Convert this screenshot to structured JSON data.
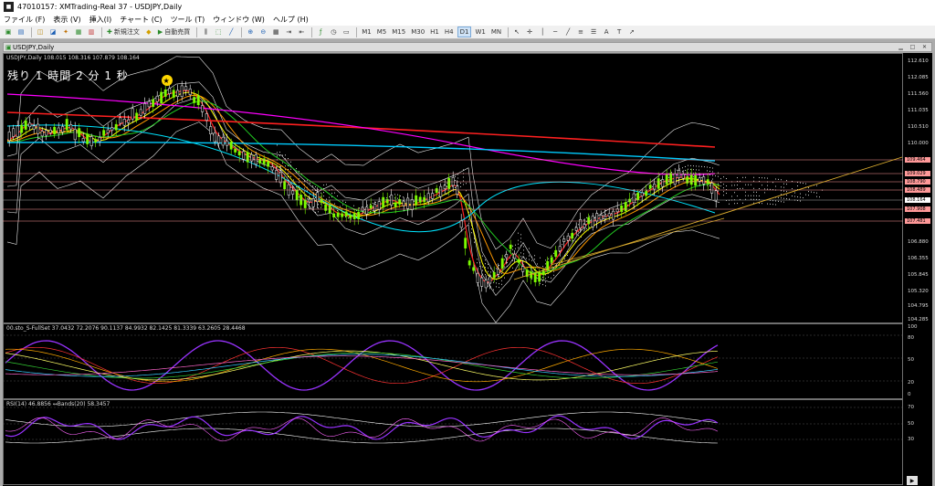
{
  "app": {
    "title": "47010157: XMTrading-Real 37 - USDJPY,Daily",
    "icon": "mt4-app-icon"
  },
  "menu": [
    "ファイル (F)",
    "表示 (V)",
    "挿入(I)",
    "チャート (C)",
    "ツール (T)",
    "ウィンドウ (W)",
    "ヘルプ (H)"
  ],
  "toolbar": {
    "new_order": "新規注文",
    "auto_trading": "自動売買",
    "timeframes": [
      "M1",
      "M5",
      "M15",
      "M30",
      "H1",
      "H4",
      "D1",
      "W1",
      "MN"
    ],
    "text_tool": "A"
  },
  "chart_window": {
    "title": "USDJPY,Daily",
    "header": "USDJPY,Daily 108.015 108.316 107.879 108.164",
    "countdown": "残り 1 時間 2 分 1 秒",
    "price_axis": [
      "112.610",
      "112.085",
      "111.560",
      "111.035",
      "110.510",
      "110.000",
      "109.464",
      "109.029",
      "108.790",
      "108.489",
      "108.164",
      "107.908",
      "107.481",
      "106.880",
      "106.355",
      "105.845",
      "105.320",
      "104.795",
      "104.285"
    ],
    "price_badges": [
      {
        "value": "109.464",
        "color": "#ff9999"
      },
      {
        "value": "109.029",
        "color": "#ff9999"
      },
      {
        "value": "108.790",
        "color": "#ff9999"
      },
      {
        "value": "108.489",
        "color": "#ff9999"
      },
      {
        "value": "108.164",
        "color": "#ffffff"
      },
      {
        "value": "107.908",
        "color": "#ff9999"
      },
      {
        "value": "107.481",
        "color": "#ff9999"
      }
    ],
    "stoch_label": "00.sto_S-FullSet 37.0432 72.2076 90.1137 84.9932 82.1425 81.3339 63.2605 28.4468",
    "stoch_axis": [
      "100",
      "80",
      "50",
      "20",
      "0"
    ],
    "rsi_label": "RSI(14) 46.8856 ↔Bands(20) 58.3457",
    "rsi_axis": [
      "70",
      "50",
      "30"
    ]
  },
  "colors": {
    "background": "#000000",
    "bull_candle": "#7CFC00",
    "bear_candle": "#ffffff",
    "ma_red": "#ff2020",
    "ma_magenta": "#ff00ff",
    "ma_cyan": "#00ccff",
    "ma_orange": "#ff9900",
    "ma_yellow": "#ffff00",
    "ma_green": "#22cc22",
    "stoch_purple": "#9933ff"
  }
}
